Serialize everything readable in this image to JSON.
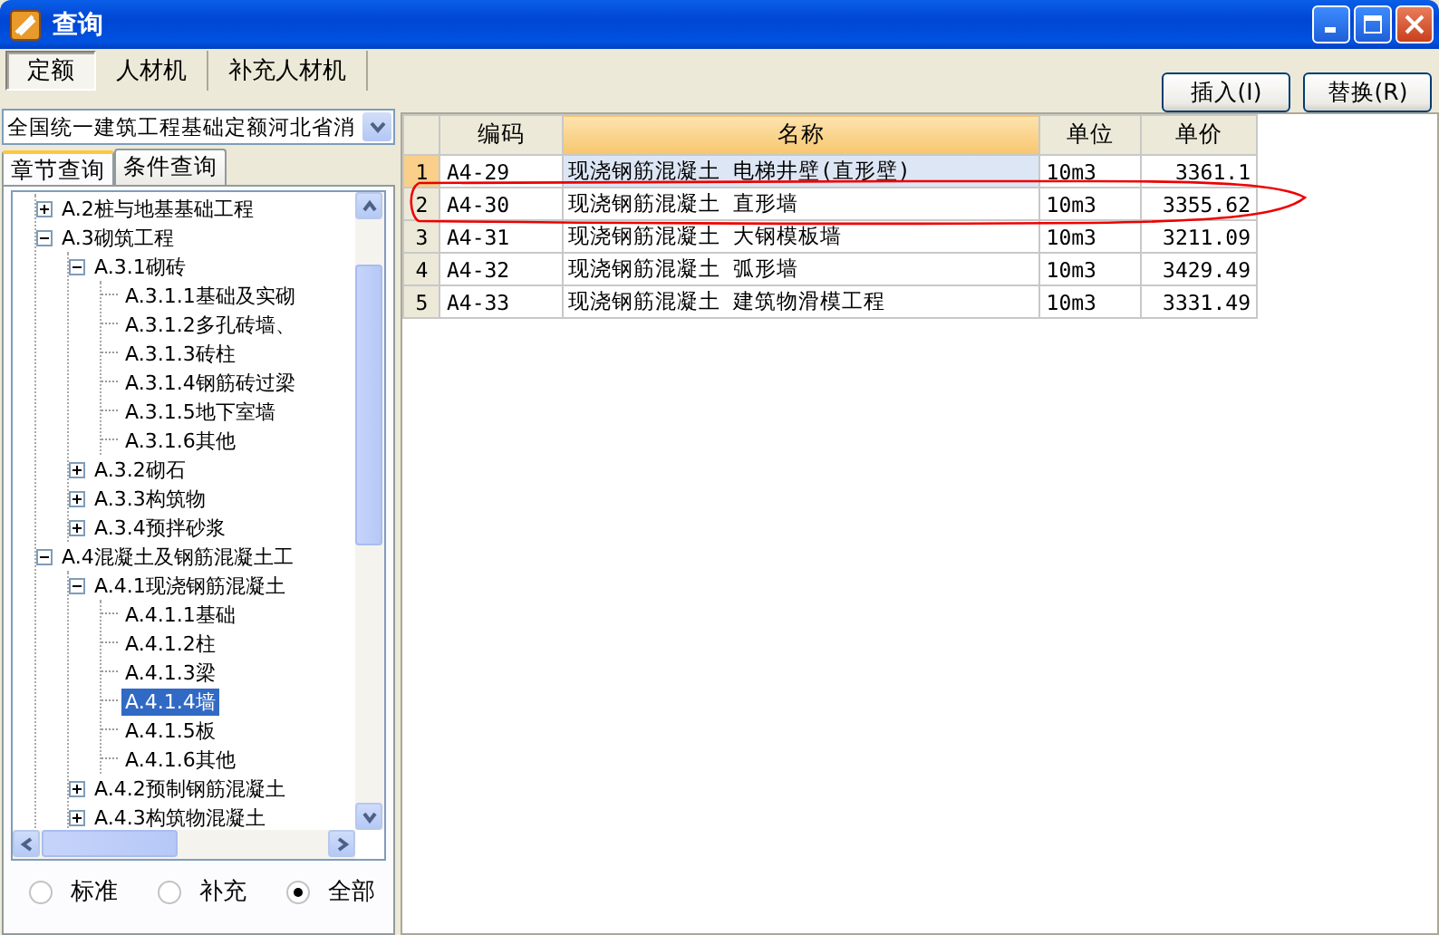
{
  "window": {
    "title": "查询"
  },
  "tabs": [
    {
      "label": "定额",
      "selected": true
    },
    {
      "label": "人材机",
      "selected": false
    },
    {
      "label": "补充人材机",
      "selected": false
    }
  ],
  "buttons": [
    "插入(I)",
    "替换(R)"
  ],
  "quota_library": {
    "value": "全国统一建筑工程基础定额河北省消"
  },
  "query_tabs": [
    {
      "label": "章节查询",
      "selected": true
    },
    {
      "label": "条件查询",
      "selected": false
    }
  ],
  "tree": [
    {
      "label": "A.2桩与地基基础工程",
      "expanded": false,
      "selected": false
    },
    {
      "label": "A.3砌筑工程",
      "expanded": true,
      "selected": false,
      "children": [
        {
          "label": "A.3.1砌砖",
          "expanded": true,
          "selected": false,
          "children": [
            {
              "label": "A.3.1.1基础及实砌",
              "selected": false
            },
            {
              "label": "A.3.1.2多孔砖墙、",
              "selected": false
            },
            {
              "label": "A.3.1.3砖柱",
              "selected": false
            },
            {
              "label": "A.3.1.4钢筋砖过梁",
              "selected": false
            },
            {
              "label": "A.3.1.5地下室墙",
              "selected": false
            },
            {
              "label": "A.3.1.6其他",
              "selected": false
            }
          ]
        },
        {
          "label": "A.3.2砌石",
          "expanded": false,
          "selected": false
        },
        {
          "label": "A.3.3构筑物",
          "expanded": false,
          "selected": false
        },
        {
          "label": "A.3.4预拌砂浆",
          "expanded": false,
          "selected": false
        }
      ]
    },
    {
      "label": "A.4混凝土及钢筋混凝土工",
      "expanded": true,
      "selected": false,
      "children": [
        {
          "label": "A.4.1现浇钢筋混凝土",
          "expanded": true,
          "selected": false,
          "children": [
            {
              "label": "A.4.1.1基础",
              "selected": false
            },
            {
              "label": "A.4.1.2柱",
              "selected": false
            },
            {
              "label": "A.4.1.3梁",
              "selected": false
            },
            {
              "label": "A.4.1.4墙",
              "selected": true
            },
            {
              "label": "A.4.1.5板",
              "selected": false
            },
            {
              "label": "A.4.1.6其他",
              "selected": false
            }
          ]
        },
        {
          "label": "A.4.2预制钢筋混凝土",
          "expanded": false,
          "selected": false
        },
        {
          "label": "A.4.3构筑物混凝土",
          "expanded": false,
          "selected": false
        }
      ]
    }
  ],
  "filter": [
    {
      "label": "标准",
      "selected": false
    },
    {
      "label": "补充",
      "selected": false
    },
    {
      "label": "全部",
      "selected": true
    }
  ],
  "table": {
    "columns": [
      {
        "label": "编码",
        "selected": false
      },
      {
        "label": "名称",
        "selected": true
      },
      {
        "label": "单位",
        "selected": false
      },
      {
        "label": "单价",
        "selected": false
      }
    ],
    "rows": [
      {
        "number": "1",
        "selected": true,
        "marked": false,
        "cells": [
          "A4-29",
          "现浇钢筋混凝土 电梯井壁(直形壁)",
          "10m3",
          "3361.1"
        ]
      },
      {
        "number": "2",
        "selected": false,
        "marked": true,
        "cells": [
          "A4-30",
          "现浇钢筋混凝土 直形墙",
          "10m3",
          "3355.62"
        ]
      },
      {
        "number": "3",
        "selected": false,
        "marked": false,
        "cells": [
          "A4-31",
          "现浇钢筋混凝土 大钢模板墙",
          "10m3",
          "3211.09"
        ]
      },
      {
        "number": "4",
        "selected": false,
        "marked": false,
        "cells": [
          "A4-32",
          "现浇钢筋混凝土 弧形墙",
          "10m3",
          "3429.49"
        ]
      },
      {
        "number": "5",
        "selected": false,
        "marked": false,
        "cells": [
          "A4-33",
          "现浇钢筋混凝土 建筑物滑模工程",
          "10m3",
          "3331.49"
        ]
      }
    ]
  }
}
